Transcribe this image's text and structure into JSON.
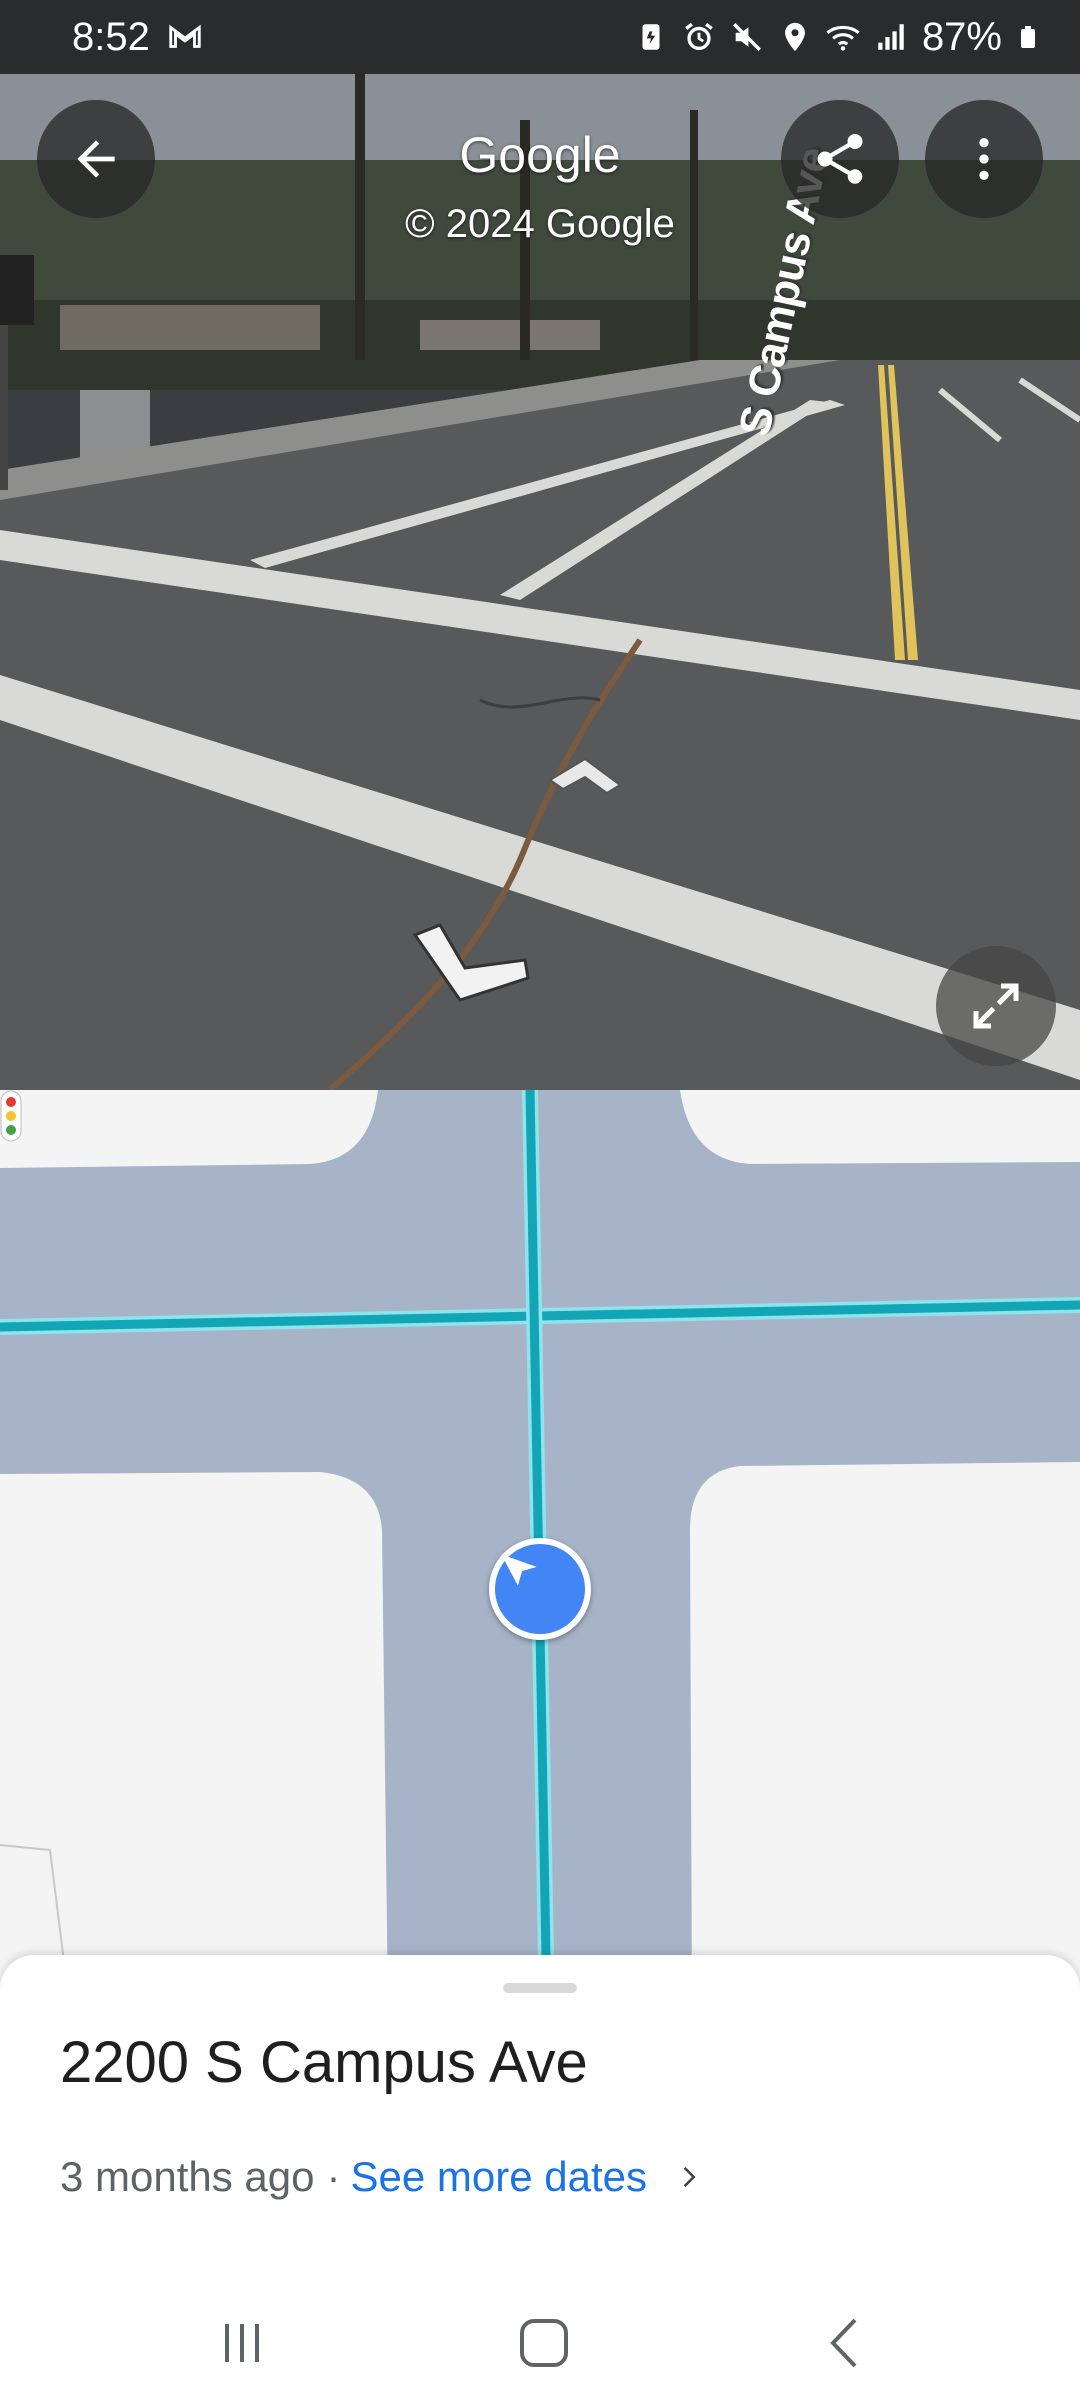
{
  "status_bar": {
    "time": "8:52",
    "battery": "87%",
    "icons": [
      "gmail-icon",
      "battery-saver-icon",
      "alarm-icon",
      "mute-icon",
      "location-icon",
      "wifi-icon",
      "signal-icon",
      "battery-icon"
    ]
  },
  "header": {
    "title": "Google",
    "copyright": "© 2024 Google",
    "back_icon": "arrow-back-icon",
    "share_icon": "share-icon",
    "more_icon": "more-vert-icon"
  },
  "street_view": {
    "street_label": "S Campus Ave",
    "expand_icon": "expand-icon"
  },
  "map": {
    "road_color": "#a7b4c8",
    "route_color": "#12a5b5",
    "marker_color": "#4285f4"
  },
  "place": {
    "address": "2200 S Campus Ave",
    "age": "3 months ago",
    "separator": "·",
    "see_more_dates": "See more dates"
  },
  "nav_bar": {
    "icons": [
      "recents-icon",
      "home-icon",
      "back-icon"
    ]
  }
}
